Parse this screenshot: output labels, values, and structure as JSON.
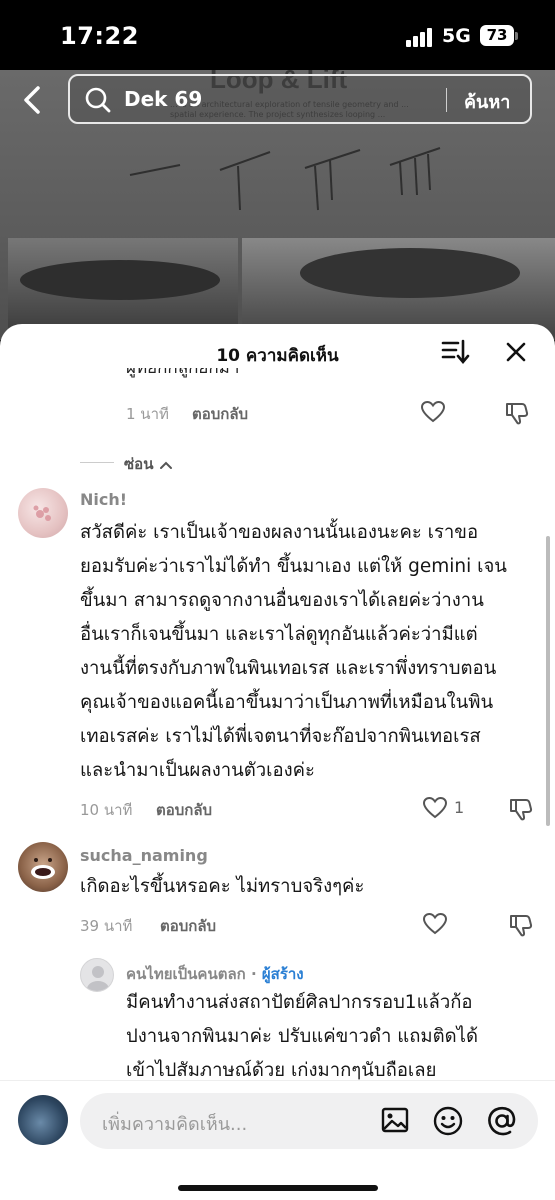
{
  "status": {
    "time": "17:22",
    "network": "5G",
    "battery": "73"
  },
  "background_post": {
    "title": "Loop & Lift",
    "subtitle": "... is an architectural exploration of tensile geometry and ... spatial experience. The project synthesizes looping ..."
  },
  "search": {
    "query": "Dek 69",
    "button_label": "ค้นหา"
  },
  "sheet": {
    "title": "10 ความคิดเห็น"
  },
  "top_reply": {
    "cut_text": "ผู้ที่ยกกลูกยกม้า",
    "time": "1 นาที",
    "reply_label": "ตอบกลับ"
  },
  "hide_label": "ซ่อน",
  "comments": [
    {
      "username": "Nich!",
      "lines": [
        "สวัสดีค่ะ เราเป็นเจ้าของผลงานนั้นเองนะคะ เราขอ",
        "ยอมรับค่ะว่าเราไม่ได้ทำ ขึ้นมาเอง แต่ให้ gemini เจน",
        "ขึ้นมา สามารถดูจากงานอื่นของเราได้เลยค่ะว่างาน",
        "อื่นเราก็เจนขึ้นมา และเราไล่ดูทุกอันแล้วค่ะว่ามีแต่",
        "งานนี้ที่ตรงกับภาพในพินเทอเรส และเราพึ่งทราบตอน",
        "คุณเจ้าของแอคนี้เอาขึ้นมาว่าเป็นภาพที่เหมือนในพิน",
        "เทอเรสค่ะ เราไม่ได้พี่เจตนาที่จะก๊อปจากพินเทอเรส",
        "และนำมาเป็นผลงานตัวเองค่ะ"
      ],
      "time": "10 นาที",
      "reply_label": "ตอบกลับ",
      "likes": "1"
    },
    {
      "username": "sucha_naming",
      "lines": [
        "เกิดอะไรขึ้นหรอคะ ไม่ทราบจริงๆค่ะ"
      ],
      "time": "39 นาที",
      "reply_label": "ตอบกลับ"
    }
  ],
  "nested_reply": {
    "username": "คนไทยเป็นคนตลก",
    "separator": " · ",
    "badge": "ผู้สร้าง",
    "lines": [
      "มีคนทำงานส่งสถาปัตย์ศิลปากรรอบ1แล้วก้อ",
      "ปงานจากพินมาค่ะ ปรับแค่ขาวดำ แถมติดได้",
      "เข้าไปสัมภาษณ์ด้วย เก่งมากๆนับถือเลย"
    ]
  },
  "composer": {
    "placeholder": "เพิ่มความคิดเห็น..."
  },
  "icons": {
    "back": "chevron-left-icon",
    "search": "search-icon",
    "sort": "sort-icon",
    "close": "close-icon",
    "heart": "heart-icon",
    "dislike": "thumbs-down-icon",
    "image": "image-icon",
    "emoji": "emoji-icon",
    "mention": "at-icon"
  }
}
